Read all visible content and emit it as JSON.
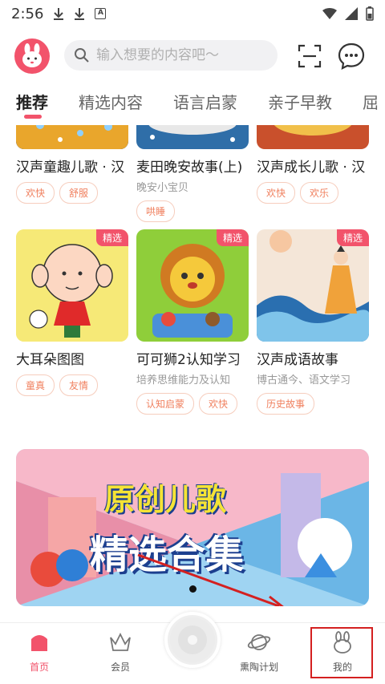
{
  "status_bar": {
    "time": "2:56"
  },
  "search": {
    "placeholder": "输入想要的内容吧～"
  },
  "tabs": [
    {
      "label": "推荐"
    },
    {
      "label": "精选内容"
    },
    {
      "label": "语言启蒙"
    },
    {
      "label": "亲子早教"
    },
    {
      "label": "屈"
    }
  ],
  "cards_row1": [
    {
      "title": "汉声童趣儿歌 · 汉",
      "subtitle": "",
      "tags": [
        "欢快",
        "舒服"
      ]
    },
    {
      "title": "麦田晚安故事(上)",
      "subtitle": "晚安小宝贝",
      "tags": [
        "哄睡"
      ]
    },
    {
      "title": "汉声成长儿歌 · 汉",
      "subtitle": "",
      "tags": [
        "欢快",
        "欢乐"
      ]
    }
  ],
  "cards_row2": [
    {
      "badge": "精选",
      "title": "大耳朵图图",
      "subtitle": "",
      "tags": [
        "童真",
        "友情"
      ]
    },
    {
      "badge": "精选",
      "title": "可可狮2认知学习",
      "subtitle": "培养思维能力及认知",
      "tags": [
        "认知启蒙",
        "欢快"
      ]
    },
    {
      "badge": "精选",
      "title": "汉声成语故事",
      "subtitle": "博古通今、语文学习",
      "tags": [
        "历史故事"
      ]
    }
  ],
  "banner": {
    "line1": "原创儿歌",
    "line2": "精选合集"
  },
  "bottom_nav": [
    {
      "label": "首页"
    },
    {
      "label": "会员"
    },
    {
      "label": "熏陶计划"
    },
    {
      "label": "我的"
    }
  ],
  "colors": {
    "accent": "#f2536b",
    "tag_text": "#f0805f",
    "annotation": "#d42020"
  }
}
